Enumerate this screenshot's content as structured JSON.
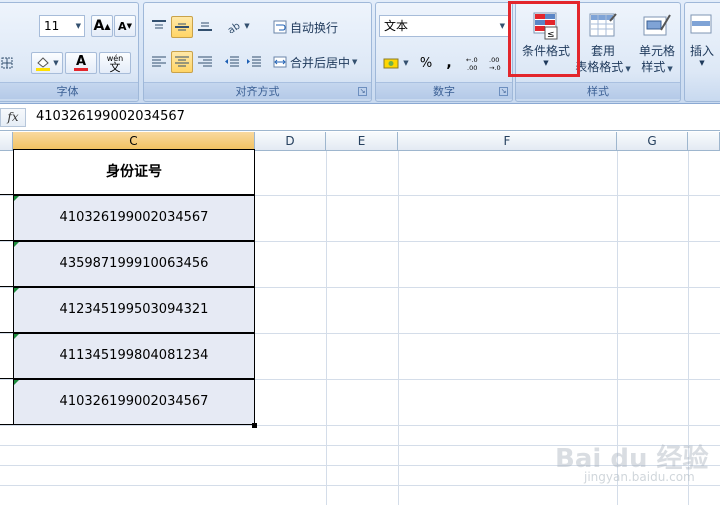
{
  "ribbon": {
    "font_group": {
      "label": "字体",
      "font_size": "11",
      "grow_label": "A",
      "shrink_label": "A",
      "font_color_label": "A",
      "wen_label": "wén",
      "wen_char": "文"
    },
    "align_group": {
      "label": "对齐方式",
      "wrap_text": "自动换行",
      "merge_center": "合并后居中"
    },
    "number_group": {
      "label": "数字",
      "format_value": "文本",
      "percent": "%",
      "comma": ",",
      "inc_decimal": "+.0 .00",
      "dec_decimal": ".00 +.0"
    },
    "styles_group": {
      "label": "样式",
      "conditional_format": "条件格式",
      "table_format_line1": "套用",
      "table_format_line2": "表格格式",
      "cell_style_line1": "单元格",
      "cell_style_line2": "样式"
    },
    "cells_group": {
      "insert": "插入"
    }
  },
  "formula_bar": {
    "fx": "fx",
    "content": "410326199002034567"
  },
  "columns": [
    "C",
    "D",
    "E",
    "F",
    "G"
  ],
  "table": {
    "header": "身份证号",
    "rows": [
      "410326199002034567",
      "435987199910063456",
      "412345199503094321",
      "411345199804081234",
      "410326199002034567"
    ]
  },
  "watermark": {
    "brand": "Bai du 经验",
    "url": "jingyan.baidu.com"
  },
  "colors": {
    "highlight_box": "#e3262c",
    "selected_column": "#f1c15f",
    "data_cell_fill": "#e6eaf4",
    "error_triangle": "#1d8c3c"
  }
}
